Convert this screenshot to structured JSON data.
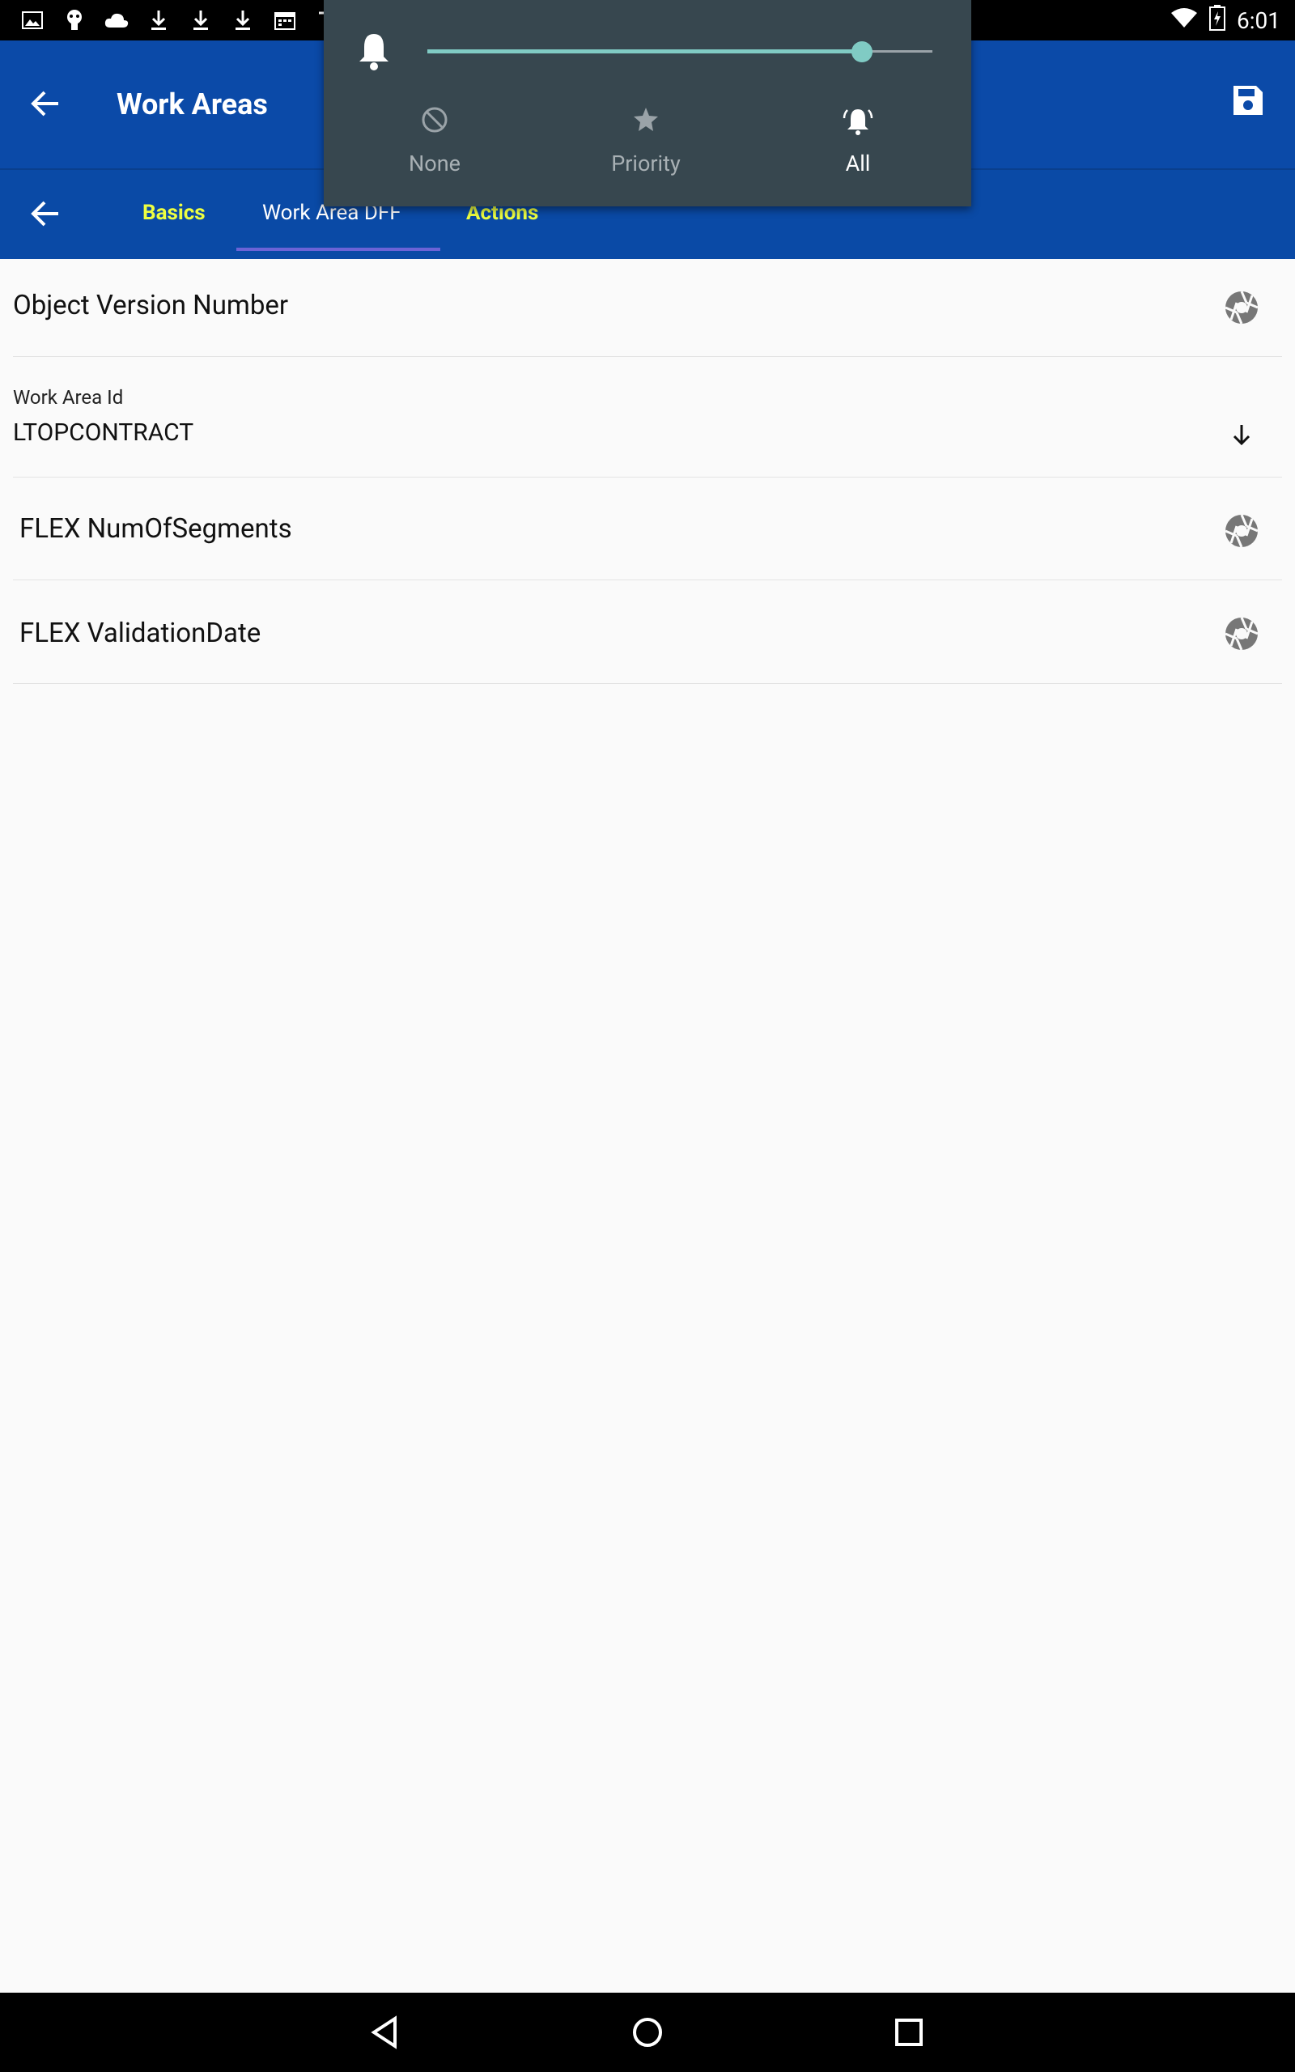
{
  "status_bar": {
    "time": "6:01",
    "left_icons": [
      "image-icon",
      "android-icon",
      "cloud-icon",
      "download-icon",
      "download-icon",
      "download-icon",
      "calendar-icon",
      "signal-icon"
    ],
    "right_icons": [
      "wifi-icon",
      "battery-icon"
    ]
  },
  "app_bar": {
    "title": "Work Areas"
  },
  "tabs": [
    {
      "label": "Basics",
      "color": "#eeff41",
      "active": false
    },
    {
      "label": "Work Area DFF",
      "color": "#ffffff",
      "active": true
    },
    {
      "label": "Actions",
      "color": "#eeff41",
      "active": false
    }
  ],
  "fields": [
    {
      "label": "Object Version Number",
      "icon": "aperture-icon"
    },
    {
      "small_label": "Work Area Id",
      "value": "LTOPCONTRACT",
      "icon": "arrow-down-icon"
    },
    {
      "label": "FLEX NumOfSegments",
      "icon": "aperture-icon"
    },
    {
      "label": "FLEX ValidationDate",
      "icon": "aperture-icon"
    }
  ],
  "volume_popup": {
    "level": 0.86,
    "modes": [
      {
        "label": "None",
        "icon": "block-icon",
        "active": false
      },
      {
        "label": "Priority",
        "icon": "star-icon",
        "active": false
      },
      {
        "label": "All",
        "icon": "bell-ring-icon",
        "active": true
      }
    ]
  },
  "colors": {
    "app_bar": "#0b4aa8",
    "accent_tab": "#eeff41",
    "popup_bg": "#37474f",
    "slider": "#80cbc4"
  }
}
